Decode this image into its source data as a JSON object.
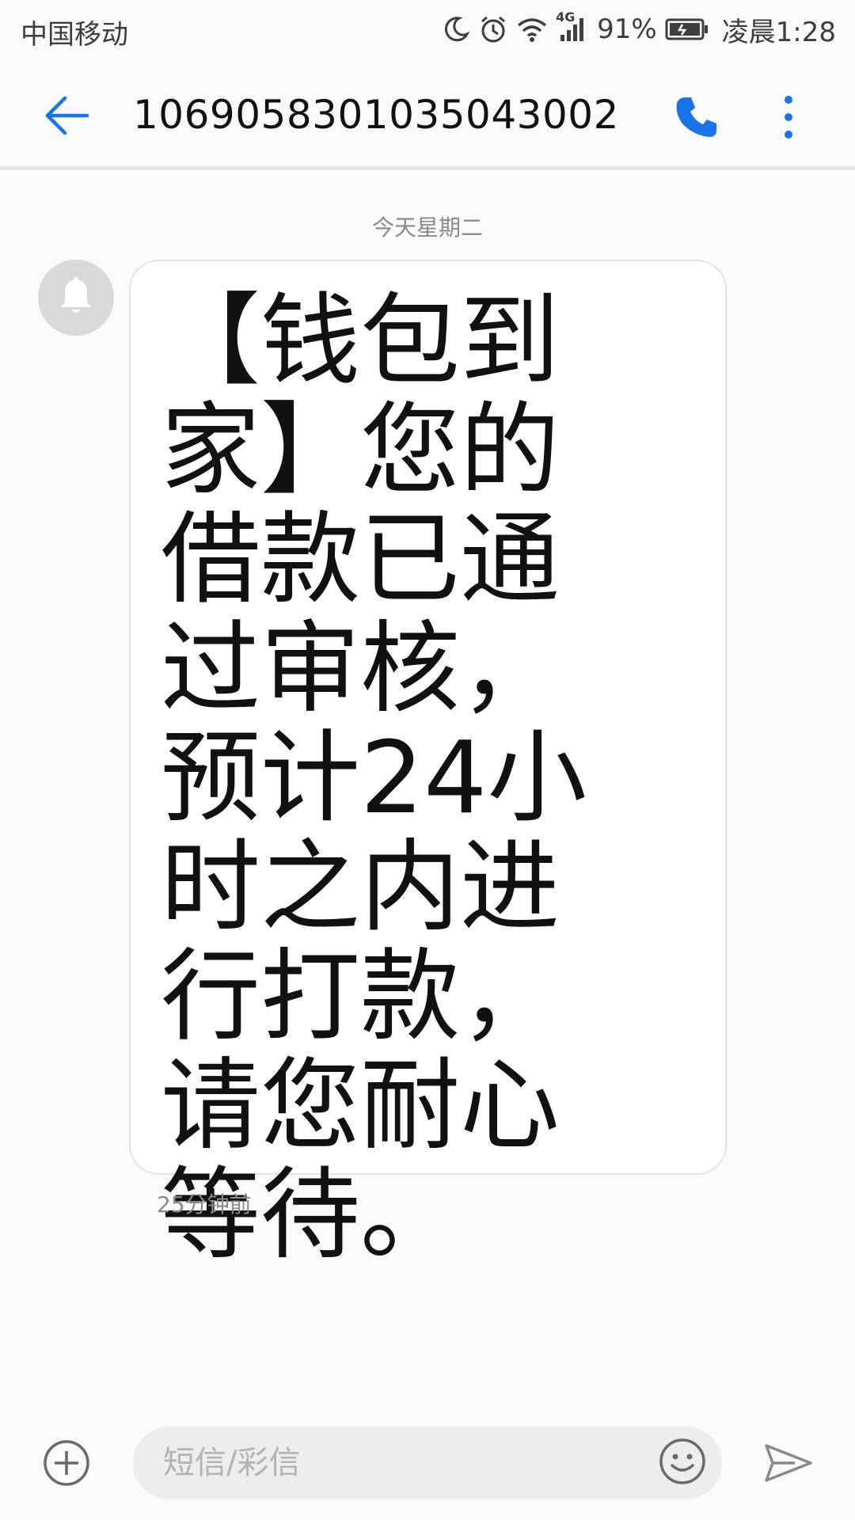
{
  "status_bar": {
    "carrier": "中国移动",
    "network": "4G",
    "battery": "91%",
    "time": "凌晨1:28",
    "icons": [
      "moon-icon",
      "alarm-icon",
      "wifi-icon",
      "signal-icon",
      "battery-icon"
    ]
  },
  "header": {
    "title": "1069058301035043002",
    "back_icon": "arrow-left-icon",
    "call_icon": "phone-icon",
    "more_icon": "more-vert-icon",
    "accent_color": "#1a73e8"
  },
  "conversation": {
    "date_label": "今天星期二",
    "messages": [
      {
        "text": "【钱包到家】您的借款已通过审核，预计24小时之内进行打款，请您耐心等待。",
        "time": "25分钟前",
        "avatar_icon": "bell-icon"
      }
    ]
  },
  "composer": {
    "placeholder": "短信/彩信",
    "value": "",
    "add_icon": "plus-circle-icon",
    "emoji_icon": "smiley-icon",
    "send_icon": "send-icon"
  }
}
